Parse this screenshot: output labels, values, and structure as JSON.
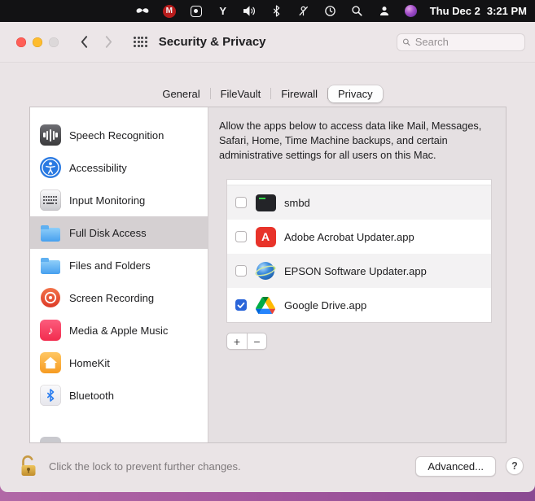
{
  "menu_bar": {
    "date": "Thu Dec 2",
    "time": "3:21 PM",
    "status_icons": [
      "moustache-icon",
      "mcafee-icon",
      "launcher-app-icon",
      "tuner-icon",
      "volume-icon",
      "bluetooth-icon",
      "crossed-device-icon",
      "clock-icon",
      "spotlight-search-icon",
      "fast-user-switch-icon",
      "purple-app-icon"
    ]
  },
  "titlebar": {
    "title": "Security & Privacy",
    "search_placeholder": "Search"
  },
  "tabs": [
    {
      "label": "General",
      "active": false
    },
    {
      "label": "FileVault",
      "active": false
    },
    {
      "label": "Firewall",
      "active": false
    },
    {
      "label": "Privacy",
      "active": true
    }
  ],
  "sidebar": {
    "selected": "Full Disk Access",
    "items": [
      {
        "label": "Speech Recognition",
        "icon": "speech-recognition-icon"
      },
      {
        "label": "Accessibility",
        "icon": "accessibility-icon"
      },
      {
        "label": "Input Monitoring",
        "icon": "keyboard-icon"
      },
      {
        "label": "Full Disk Access",
        "icon": "blue-folder-icon"
      },
      {
        "label": "Files and Folders",
        "icon": "blue-folder-icon"
      },
      {
        "label": "Screen Recording",
        "icon": "record-circle-icon"
      },
      {
        "label": "Media & Apple Music",
        "icon": "music-note-icon"
      },
      {
        "label": "HomeKit",
        "icon": "house-icon"
      },
      {
        "label": "Bluetooth",
        "icon": "bluetooth-icon"
      }
    ]
  },
  "privacy_pane": {
    "description": "Allow the apps below to access data like Mail, Messages, Safari, Home, Time Machine backups, and certain administrative settings for all users on this Mac.",
    "apps": [
      {
        "name": "smbd",
        "checked": false,
        "icon": "terminal-exec-icon"
      },
      {
        "name": "Adobe Acrobat Updater.app",
        "checked": false,
        "icon": "adobe-red-icon"
      },
      {
        "name": "EPSON Software Updater.app",
        "checked": false,
        "icon": "globe-updater-icon"
      },
      {
        "name": "Google Drive.app",
        "checked": true,
        "icon": "google-drive-icon"
      }
    ],
    "add_label": "+",
    "remove_label": "−"
  },
  "footer": {
    "lock_text": "Click the lock to prevent further changes.",
    "advanced_label": "Advanced...",
    "help_label": "?"
  },
  "colors": {
    "accent_blue": "#2a65d9",
    "selected_row": "#d5d0d2",
    "wallpaper_purple": "#a2569d",
    "menubar_black": "#121214"
  }
}
